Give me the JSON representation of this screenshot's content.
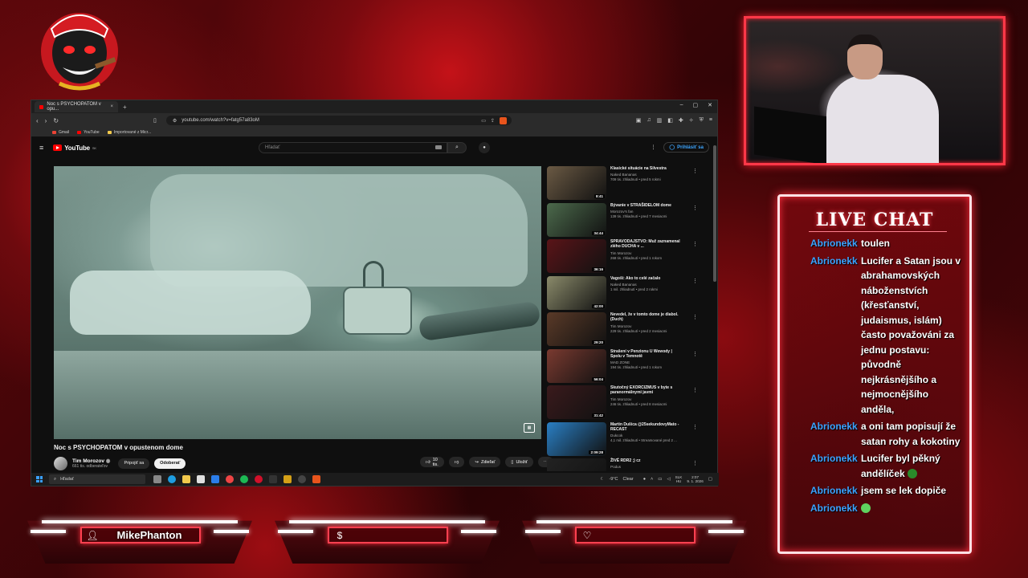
{
  "browser": {
    "tab_title": "Noc s PSYCHOPATOM v opu...",
    "tab_close": "×",
    "new_tab": "+",
    "window_controls": [
      "–",
      "▢",
      "✕"
    ],
    "url": "youtube.com/watch?v=fatg57a83oM",
    "bookmarks": [
      {
        "label": "Gmail",
        "color": "#ea4335"
      },
      {
        "label": "YouTube",
        "color": "#ff0000"
      },
      {
        "label": "Importované z Micr...",
        "color": "#f2c94c"
      }
    ]
  },
  "youtube": {
    "logo_text": "YouTube",
    "logo_region": "SK",
    "search_placeholder": "Hľadať",
    "signin_label": "Prihlásiť sa",
    "video_title": "Noc s PSYCHOPATOM v opustenom dome",
    "channel_name": "Tim Morozov",
    "subscribers": "661 tis. odberateľov",
    "join_label": "Pripojiť sa",
    "subscribe_label": "Odoberať",
    "likes": "10 tis.",
    "share_label": "Zdieľať",
    "save_label": "Uložiť",
    "more_label": "⋯"
  },
  "recommendations": [
    {
      "title": "Klasické situácie na Silvestra",
      "channel": "Naked Bananas",
      "meta": "709 tis. zhliadnutí • pred 5 rokmi",
      "duration": "8:41",
      "color": "#6b5a44"
    },
    {
      "title": "Bývanie v STRAŠIDELOM dome",
      "channel": "Morozov's fan",
      "meta": "139 tis. zhliadnutí • pred 7 mesiacmi",
      "duration": "34:44",
      "color": "#4c6a4c"
    },
    {
      "title": "SPRAVODAJSTVO: Muž zaznamenal zlého DUCHA v ...",
      "channel": "Tim Morozov",
      "meta": "268 tis. zhliadnutí • pred 1 rokom",
      "duration": "36:16",
      "color": "#5a1418"
    },
    {
      "title": "Vagoši: Ako to celé začalo",
      "channel": "Naked Bananas",
      "meta": "1 mil. zhliadnutí • pred 2 rokmi",
      "duration": "42:00",
      "color": "#8a8a6a"
    },
    {
      "title": "Nevedel, že v tomto dome je diabol. (Duch)",
      "channel": "Tim Morozov",
      "meta": "229 tis. zhliadnutí • pred 2 mesiacmi",
      "duration": "29:20",
      "color": "#5a3a28"
    },
    {
      "title": "Strašení v Penzionu U Wewody | Spolu v Temnotě",
      "channel": "MAD ZONE",
      "meta": "194 tis. zhliadnutí • pred 1 rokom",
      "duration": "56:04",
      "color": "#7a3a30"
    },
    {
      "title": "Skutočný EXORCIZMUS v byte s paranormálnymi javmi",
      "channel": "Tim Morozov",
      "meta": "246 tis. zhliadnutí • pred 8 mesiacmi",
      "duration": "31:42",
      "color": "#3a1a1c"
    },
    {
      "title": "Martin Dušica @25sekundovyMato - RECAST",
      "channel": "Dukcok",
      "meta": "4,1 mil. zhliadnutí • Streamované pred 2 ...",
      "duration": "2:09:28",
      "color": "#2a7fc4"
    },
    {
      "title": "ŽIVÉ RDR2 ;) cz",
      "channel": "Podus",
      "meta": "",
      "duration": "",
      "color": "#222222"
    }
  ],
  "taskbar": {
    "search_placeholder": "Hľadať",
    "weather": "-9°C",
    "weather_label": "Clear",
    "lang_top": "SLK",
    "lang_bottom": "HU",
    "time": "2:07",
    "date": "9. 1. 2026"
  },
  "chat": {
    "header": "LIVE CHAT",
    "messages": [
      {
        "user": "Abrionekk",
        "text": "toulen"
      },
      {
        "user": "Abrionekk",
        "text": "Lucifer a Satan jsou v abrahamovských náboženstvích (křesťanství, judaismus, islám) často považováni za jednu postavu: původně nejkrásnějšího a nejmocnějšího anděla,"
      },
      {
        "user": "Abrionekk",
        "text": "a oni tam popisují že satan rohy a kokotiny"
      },
      {
        "user": "Abrionekk",
        "text": "Lucifer byl pěkný andělíček"
      },
      {
        "user": "Abrionekk",
        "text": "jsem se lek dopiče"
      },
      {
        "user": "Abrionekk",
        "text": ""
      }
    ]
  },
  "panels": [
    {
      "icon": "user-icon",
      "label": "MikePhanton"
    },
    {
      "icon": "dollar-icon",
      "label": ""
    },
    {
      "icon": "heart-icon",
      "label": ""
    }
  ]
}
